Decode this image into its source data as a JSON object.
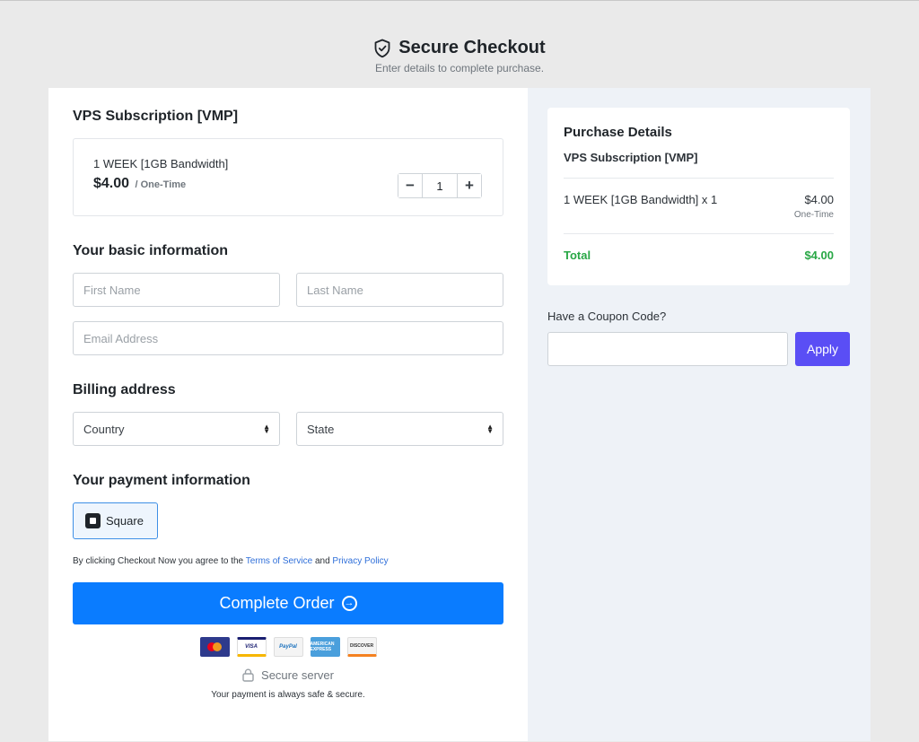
{
  "header": {
    "title": "Secure Checkout",
    "subtitle": "Enter details to complete purchase."
  },
  "product": {
    "heading": "VPS Subscription [VMP]",
    "option": "1 WEEK [1GB Bandwidth]",
    "price": "$4.00",
    "period": "/ One-Time",
    "quantity": "1",
    "minus": "−",
    "plus": "+"
  },
  "basic_info": {
    "heading": "Your basic information",
    "first_name_placeholder": "First Name",
    "last_name_placeholder": "Last Name",
    "email_placeholder": "Email Address"
  },
  "billing": {
    "heading": "Billing address",
    "country": "Country",
    "state": "State"
  },
  "payment": {
    "heading": "Your payment information",
    "method": "Square",
    "terms_prefix": "By clicking Checkout Now you agree to the ",
    "terms_link": "Terms of Service",
    "terms_and": " and ",
    "privacy_link": "Privacy Policy",
    "submit_label": "Complete Order",
    "card_logos": {
      "visa": "VISA",
      "paypal": "PayPal",
      "amex": "AMERICAN EXPRESS",
      "discover": "DISCOVER"
    },
    "secure_server": "Secure server",
    "safe_text": "Your payment is always safe & secure."
  },
  "purchase_details": {
    "title": "Purchase Details",
    "product": "VPS Subscription [VMP]",
    "line_item": "1 WEEK [1GB Bandwidth] x 1",
    "line_price": "$4.00",
    "line_period": "One-Time",
    "total_label": "Total",
    "total_value": "$4.00"
  },
  "coupon": {
    "label": "Have a Coupon Code?",
    "value": "",
    "apply_label": "Apply"
  },
  "colors": {
    "primary_button": "#0a7cff",
    "apply_button": "#5a4ef5",
    "total_green": "#28a745",
    "link_blue": "#2f6fd9"
  }
}
